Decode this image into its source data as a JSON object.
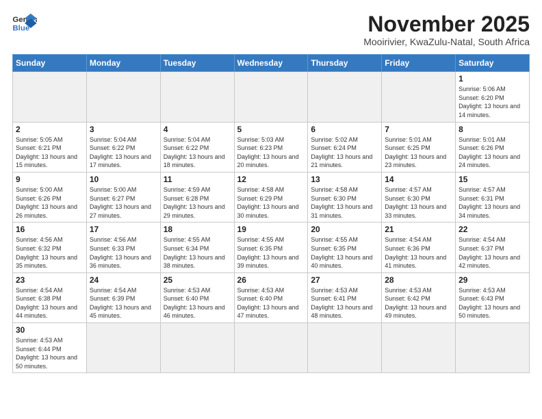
{
  "header": {
    "logo_general": "General",
    "logo_blue": "Blue",
    "month_title": "November 2025",
    "subtitle": "Mooirivier, KwaZulu-Natal, South Africa"
  },
  "weekdays": [
    "Sunday",
    "Monday",
    "Tuesday",
    "Wednesday",
    "Thursday",
    "Friday",
    "Saturday"
  ],
  "weeks": [
    [
      {
        "day": "",
        "info": ""
      },
      {
        "day": "",
        "info": ""
      },
      {
        "day": "",
        "info": ""
      },
      {
        "day": "",
        "info": ""
      },
      {
        "day": "",
        "info": ""
      },
      {
        "day": "",
        "info": ""
      },
      {
        "day": "1",
        "info": "Sunrise: 5:06 AM\nSunset: 6:20 PM\nDaylight: 13 hours and 14 minutes."
      }
    ],
    [
      {
        "day": "2",
        "info": "Sunrise: 5:05 AM\nSunset: 6:21 PM\nDaylight: 13 hours and 15 minutes."
      },
      {
        "day": "3",
        "info": "Sunrise: 5:04 AM\nSunset: 6:22 PM\nDaylight: 13 hours and 17 minutes."
      },
      {
        "day": "4",
        "info": "Sunrise: 5:04 AM\nSunset: 6:22 PM\nDaylight: 13 hours and 18 minutes."
      },
      {
        "day": "5",
        "info": "Sunrise: 5:03 AM\nSunset: 6:23 PM\nDaylight: 13 hours and 20 minutes."
      },
      {
        "day": "6",
        "info": "Sunrise: 5:02 AM\nSunset: 6:24 PM\nDaylight: 13 hours and 21 minutes."
      },
      {
        "day": "7",
        "info": "Sunrise: 5:01 AM\nSunset: 6:25 PM\nDaylight: 13 hours and 23 minutes."
      },
      {
        "day": "8",
        "info": "Sunrise: 5:01 AM\nSunset: 6:26 PM\nDaylight: 13 hours and 24 minutes."
      }
    ],
    [
      {
        "day": "9",
        "info": "Sunrise: 5:00 AM\nSunset: 6:26 PM\nDaylight: 13 hours and 26 minutes."
      },
      {
        "day": "10",
        "info": "Sunrise: 5:00 AM\nSunset: 6:27 PM\nDaylight: 13 hours and 27 minutes."
      },
      {
        "day": "11",
        "info": "Sunrise: 4:59 AM\nSunset: 6:28 PM\nDaylight: 13 hours and 29 minutes."
      },
      {
        "day": "12",
        "info": "Sunrise: 4:58 AM\nSunset: 6:29 PM\nDaylight: 13 hours and 30 minutes."
      },
      {
        "day": "13",
        "info": "Sunrise: 4:58 AM\nSunset: 6:30 PM\nDaylight: 13 hours and 31 minutes."
      },
      {
        "day": "14",
        "info": "Sunrise: 4:57 AM\nSunset: 6:30 PM\nDaylight: 13 hours and 33 minutes."
      },
      {
        "day": "15",
        "info": "Sunrise: 4:57 AM\nSunset: 6:31 PM\nDaylight: 13 hours and 34 minutes."
      }
    ],
    [
      {
        "day": "16",
        "info": "Sunrise: 4:56 AM\nSunset: 6:32 PM\nDaylight: 13 hours and 35 minutes."
      },
      {
        "day": "17",
        "info": "Sunrise: 4:56 AM\nSunset: 6:33 PM\nDaylight: 13 hours and 36 minutes."
      },
      {
        "day": "18",
        "info": "Sunrise: 4:55 AM\nSunset: 6:34 PM\nDaylight: 13 hours and 38 minutes."
      },
      {
        "day": "19",
        "info": "Sunrise: 4:55 AM\nSunset: 6:35 PM\nDaylight: 13 hours and 39 minutes."
      },
      {
        "day": "20",
        "info": "Sunrise: 4:55 AM\nSunset: 6:35 PM\nDaylight: 13 hours and 40 minutes."
      },
      {
        "day": "21",
        "info": "Sunrise: 4:54 AM\nSunset: 6:36 PM\nDaylight: 13 hours and 41 minutes."
      },
      {
        "day": "22",
        "info": "Sunrise: 4:54 AM\nSunset: 6:37 PM\nDaylight: 13 hours and 42 minutes."
      }
    ],
    [
      {
        "day": "23",
        "info": "Sunrise: 4:54 AM\nSunset: 6:38 PM\nDaylight: 13 hours and 44 minutes."
      },
      {
        "day": "24",
        "info": "Sunrise: 4:54 AM\nSunset: 6:39 PM\nDaylight: 13 hours and 45 minutes."
      },
      {
        "day": "25",
        "info": "Sunrise: 4:53 AM\nSunset: 6:40 PM\nDaylight: 13 hours and 46 minutes."
      },
      {
        "day": "26",
        "info": "Sunrise: 4:53 AM\nSunset: 6:40 PM\nDaylight: 13 hours and 47 minutes."
      },
      {
        "day": "27",
        "info": "Sunrise: 4:53 AM\nSunset: 6:41 PM\nDaylight: 13 hours and 48 minutes."
      },
      {
        "day": "28",
        "info": "Sunrise: 4:53 AM\nSunset: 6:42 PM\nDaylight: 13 hours and 49 minutes."
      },
      {
        "day": "29",
        "info": "Sunrise: 4:53 AM\nSunset: 6:43 PM\nDaylight: 13 hours and 50 minutes."
      }
    ],
    [
      {
        "day": "30",
        "info": "Sunrise: 4:53 AM\nSunset: 6:44 PM\nDaylight: 13 hours and 50 minutes."
      },
      {
        "day": "",
        "info": ""
      },
      {
        "day": "",
        "info": ""
      },
      {
        "day": "",
        "info": ""
      },
      {
        "day": "",
        "info": ""
      },
      {
        "day": "",
        "info": ""
      },
      {
        "day": "",
        "info": ""
      }
    ]
  ]
}
